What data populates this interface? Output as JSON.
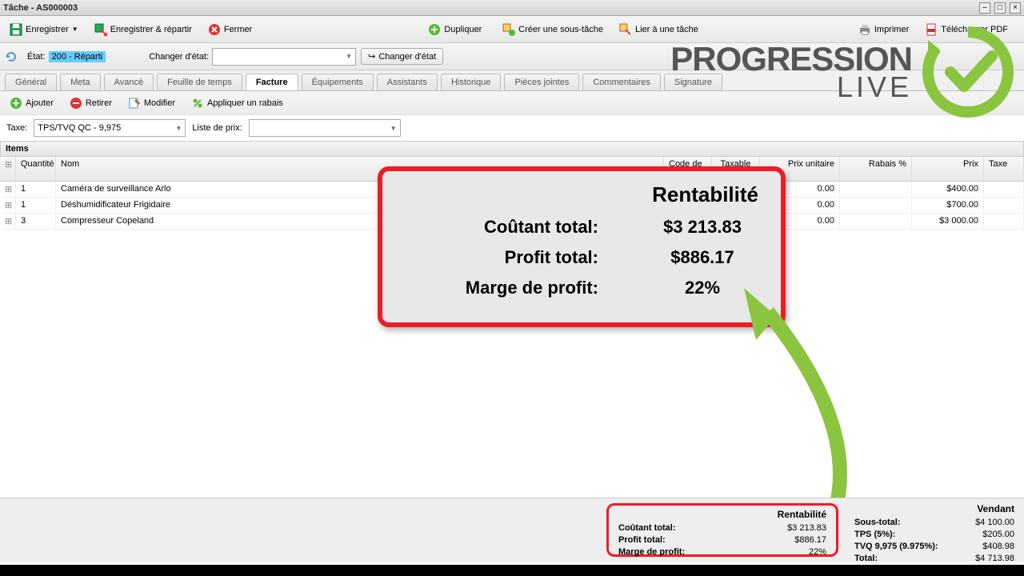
{
  "window": {
    "title": "Tâche - AS000003"
  },
  "toolbar": {
    "enregistrer": "Enregistrer",
    "enregistrer_repartir": "Enregistrer & répartir",
    "fermer": "Fermer",
    "dupliquer": "Dupliquer",
    "creer_sous_tache": "Créer une sous-tâche",
    "lier_tache": "Lier à une tâche",
    "imprimer": "Imprimer",
    "telecharger_pdf": "Télécharger PDF"
  },
  "statebar": {
    "etat_label": "État:",
    "etat_value": "200 - Réparti",
    "changer_label": "Changer d'état:",
    "changer_btn": "Changer d'état"
  },
  "tabs": [
    "Général",
    "Meta",
    "Avancé",
    "Feuille de temps",
    "Facture",
    "Équipements",
    "Assistants",
    "Historique",
    "Pièces jointes",
    "Commentaires",
    "Signature"
  ],
  "active_tab_index": 4,
  "subtoolbar": {
    "ajouter": "Ajouter",
    "retirer": "Retirer",
    "modifier": "Modifier",
    "appliquer_rabais": "Appliquer un rabais"
  },
  "filter": {
    "taxe_label": "Taxe:",
    "taxe_value": "TPS/TVQ QC - 9,975",
    "liste_prix_label": "Liste de prix:",
    "liste_prix_value": ""
  },
  "grid": {
    "title": "Items",
    "headers": {
      "qty": "Quantité",
      "name": "Nom",
      "code": "Code de p...",
      "taxable": "Taxable",
      "unit": "Prix unitaire",
      "rebate": "Rabais %",
      "price": "Prix",
      "taxe": "Taxe"
    },
    "rows": [
      {
        "qty": "1",
        "name": "Caméra de surveillance Arlo",
        "unit": "0.00",
        "price": "$400.00"
      },
      {
        "qty": "1",
        "name": "Déshumidificateur Frigidaire",
        "unit": "0.00",
        "price": "$700.00"
      },
      {
        "qty": "3",
        "name": "Compresseur Copeland",
        "unit": "0.00",
        "price": "$3 000.00"
      }
    ]
  },
  "callout": {
    "title": "Rentabilité",
    "rows": [
      {
        "label": "Coûtant total:",
        "value": "$3 213.83"
      },
      {
        "label": "Profit total:",
        "value": "$886.17"
      },
      {
        "label": "Marge de profit:",
        "value": "22%"
      }
    ]
  },
  "footer_rent": {
    "title": "Rentabilité",
    "rows": [
      {
        "label": "Coûtant total:",
        "value": "$3 213.83"
      },
      {
        "label": "Profit total:",
        "value": "$886.17"
      },
      {
        "label": "Marge de profit:",
        "value": "22%"
      }
    ]
  },
  "footer_totals": {
    "title": "Vendant",
    "rows": [
      {
        "label": "Sous-total:",
        "value": "$4 100.00"
      },
      {
        "label": "TPS (5%):",
        "value": "$205.00"
      },
      {
        "label": "TVQ 9,975 (9.975%):",
        "value": "$408.98"
      },
      {
        "label": "Total:",
        "value": "$4 713.98"
      }
    ]
  },
  "logo": {
    "line1": "PROGRESSION",
    "line2": "LIVE"
  }
}
